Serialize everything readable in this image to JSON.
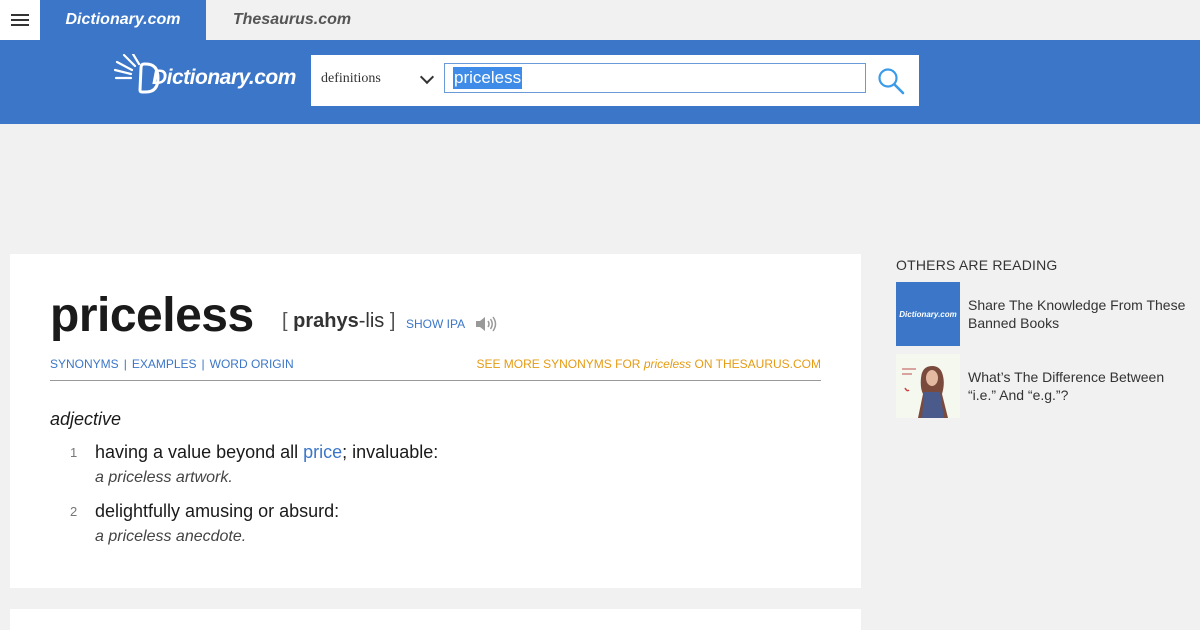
{
  "tabs": {
    "dictionary": "Dictionary.com",
    "thesaurus": "Thesaurus.com"
  },
  "header": {
    "logo_text": "Dictionary.com",
    "search": {
      "mode": "definitions",
      "query": "priceless"
    }
  },
  "entry": {
    "headword": "priceless",
    "pron_open": "[",
    "pron_stress": "prahys",
    "pron_rest": "-lis",
    "pron_close": "]",
    "show_ipa": "SHOW IPA",
    "subnav": [
      "SYNONYMS",
      "EXAMPLES",
      "WORD ORIGIN"
    ],
    "see_more_prefix": "SEE MORE SYNONYMS FOR",
    "see_more_word": "priceless",
    "see_more_suffix": "ON THESAURUS.COM",
    "part_of_speech": "adjective",
    "definitions": [
      {
        "num": "1",
        "text_before": "having a value beyond all ",
        "link": "price",
        "text_after": "; invaluable:",
        "example": "a priceless artwork."
      },
      {
        "num": "2",
        "text": "delightfully amusing or absurd:",
        "example": "a priceless anecdote."
      }
    ]
  },
  "rail": {
    "title": "OTHERS ARE READING",
    "items": [
      {
        "thumb_label": "Dictionary.com",
        "title": "Share The Knowledge From These Banned Books"
      },
      {
        "title": "What’s The Difference Between “i.e.” And “e.g.”?"
      }
    ]
  },
  "colors": {
    "brand_blue": "#3b76c8",
    "accent_orange": "#e59b12",
    "page_bg": "#f1f1f1"
  }
}
